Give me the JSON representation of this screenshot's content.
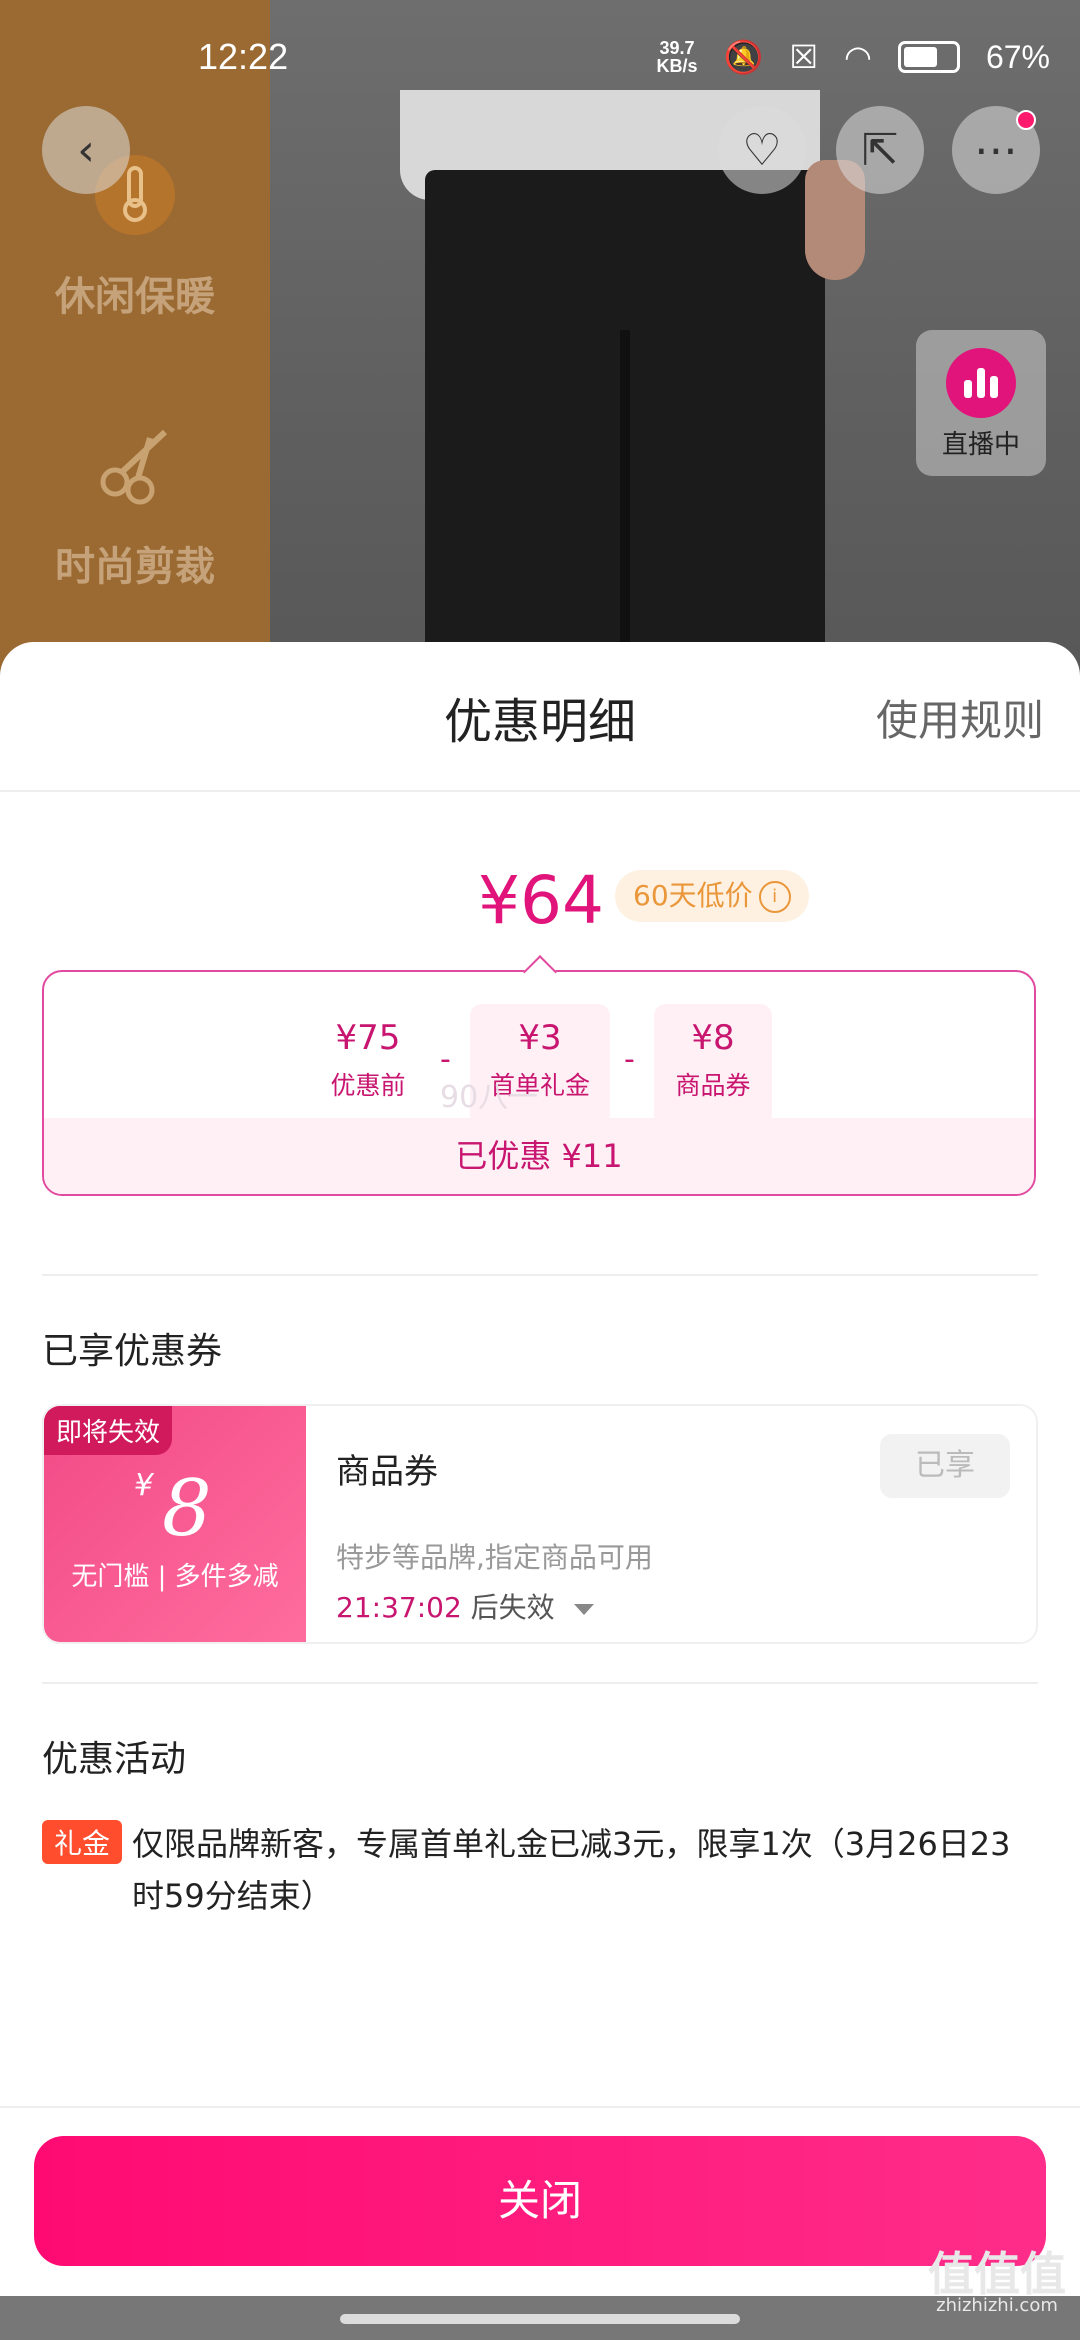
{
  "status_bar": {
    "time": "12:22",
    "net_speed_value": "39.7",
    "net_speed_unit": "KB/s",
    "battery_percent": "67%",
    "battery_level": 0.67
  },
  "product_features": [
    {
      "label": "休闲保暖",
      "icon": "thermometer-icon"
    },
    {
      "label": "时尚剪裁",
      "icon": "scissors-icon"
    }
  ],
  "live_badge": {
    "label": "直播中"
  },
  "sheet": {
    "title": "优惠明细",
    "rules_link": "使用规则",
    "final_price": "¥64",
    "low_price_badge": "60天低价",
    "breakdown": [
      {
        "value": "¥75",
        "label": "优惠前"
      },
      {
        "value": "¥3",
        "label": "首单礼金"
      },
      {
        "value": "¥8",
        "label": "商品券"
      }
    ],
    "minus_sign": "-",
    "total_saved": "已优惠 ¥11",
    "faint_text": "90八一"
  },
  "coupons_section": {
    "title": "已享优惠券",
    "coupon": {
      "tag": "即将失效",
      "currency": "¥",
      "amount": "8",
      "condition": "无门槛 | 多件多减",
      "name": "商品券",
      "description": "特步等品牌,指定商品可用",
      "expire_time": "21:37:02",
      "expire_suffix": "后失效",
      "status_button": "已享"
    }
  },
  "activity_section": {
    "title": "优惠活动",
    "badge": "礼金",
    "text": "仅限品牌新客，专属首单礼金已减3元，限享1次（3月26日23时59分结束）"
  },
  "close_button": "关闭",
  "watermark": {
    "main": "值值值",
    "sub": "zhizhizhi.com"
  },
  "colors": {
    "accent": "#e0147a",
    "button": "#ff0a73",
    "badge_orange": "#e9973a",
    "gift_badge": "#ff4d2e"
  }
}
